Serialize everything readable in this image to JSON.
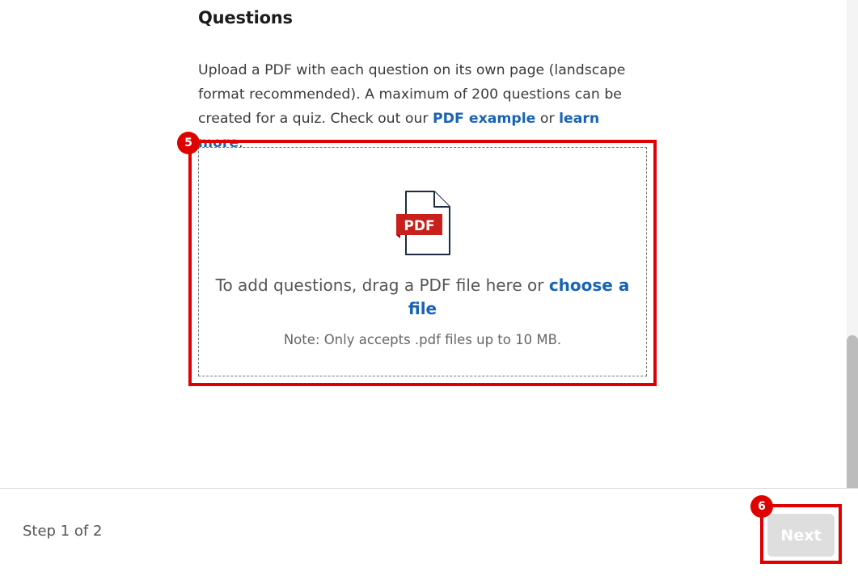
{
  "section": {
    "title": "Questions",
    "description_parts": {
      "lead": "Upload a PDF with each question on its own page (landscape format recommended). A maximum of 200 questions can be created for a quiz. Check out our ",
      "pdf_example_link": "PDF example",
      "middle": " or ",
      "learn_more_link": "learn more",
      "end": "."
    }
  },
  "dropzone": {
    "icon_label": "PDF",
    "instruction": "To add questions, drag a PDF file here or ",
    "choose_file_link": "choose a file",
    "note": "Note: Only accepts .pdf files up to 10 MB."
  },
  "footer": {
    "step_label": "Step 1 of 2",
    "next_label": "Next"
  },
  "annotations": {
    "dropzone_badge": "5",
    "next_badge": "6"
  },
  "colors": {
    "link": "#1a63b4",
    "annotation": "#e00000",
    "pdf_red": "#c8201a",
    "disabled_button": "#dedede"
  }
}
